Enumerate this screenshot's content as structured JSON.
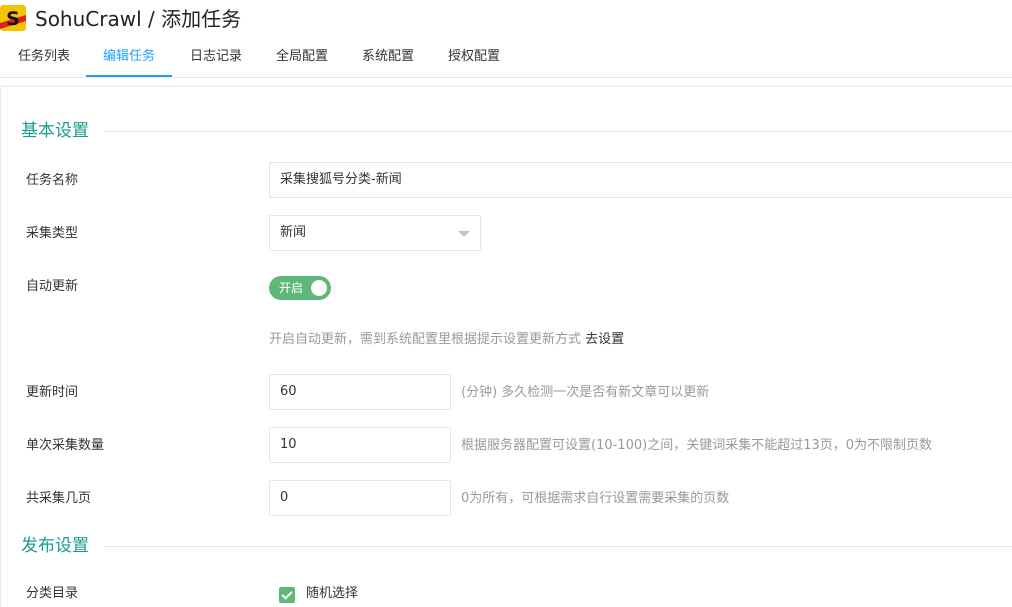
{
  "header": {
    "logo_text": "S",
    "title": "SohuCrawl / 添加任务"
  },
  "tabs": [
    {
      "label": "任务列表",
      "active": false
    },
    {
      "label": "编辑任务",
      "active": true
    },
    {
      "label": "日志记录",
      "active": false
    },
    {
      "label": "全局配置",
      "active": false
    },
    {
      "label": "系统配置",
      "active": false
    },
    {
      "label": "授权配置",
      "active": false
    }
  ],
  "sections": {
    "basic": {
      "title": "基本设置"
    },
    "publish": {
      "title": "发布设置"
    }
  },
  "form": {
    "task_name": {
      "label": "任务名称",
      "value": "采集搜狐号分类-新闻"
    },
    "crawl_type": {
      "label": "采集类型",
      "value": "新闻"
    },
    "auto_update": {
      "label": "自动更新",
      "switch_text": "开启",
      "enabled": true,
      "hint": "开启自动更新，需到系统配置里根据提示设置更新方式",
      "hint_link": "去设置"
    },
    "update_time": {
      "label": "更新时间",
      "value": "60",
      "hint": "(分钟) 多久检测一次是否有新文章可以更新"
    },
    "batch_count": {
      "label": "单次采集数量",
      "value": "10",
      "hint": "根据服务器配置可设置(10-100)之间，关键词采集不能超过13页，0为不限制页数"
    },
    "total_pages": {
      "label": "共采集几页",
      "value": "0",
      "hint": "0为所有，可根据需求自行设置需要采集的页数"
    },
    "category_dir": {
      "label": "分类目录",
      "checkbox_label": "随机选择",
      "checked": true
    }
  },
  "colors": {
    "accent_tab": "#1e9fff",
    "section_title": "#1a9c8a",
    "switch_on": "#5fb878"
  }
}
